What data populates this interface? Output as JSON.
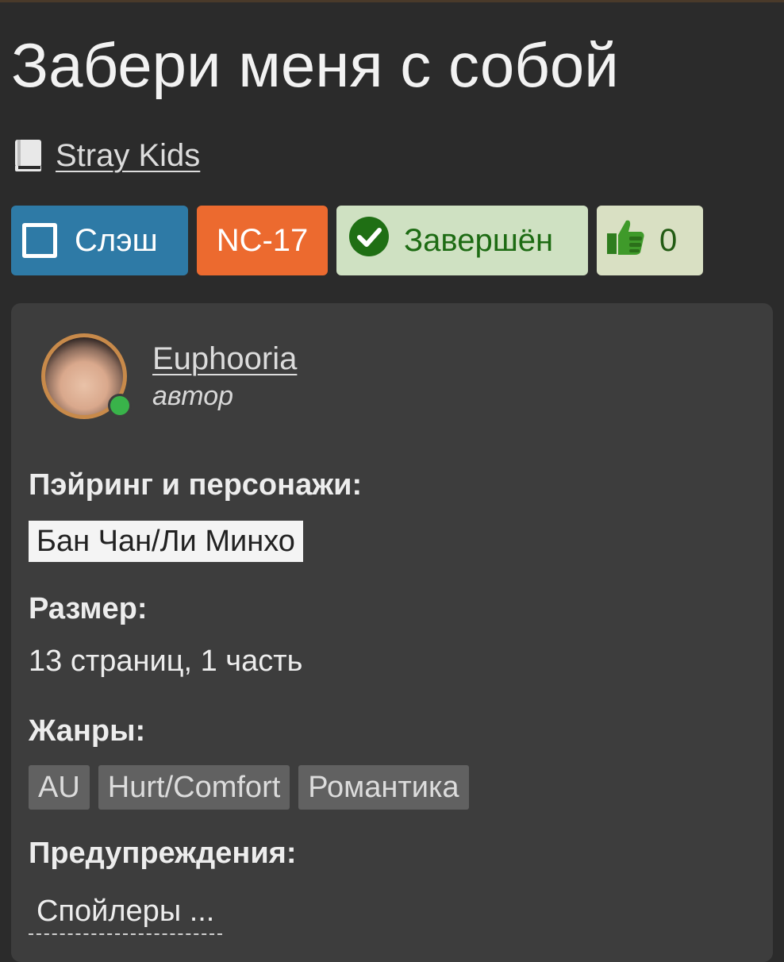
{
  "title": "Забери меня с собой",
  "fandom": {
    "icon": "book-icon",
    "name": "Stray Kids"
  },
  "badges": {
    "direction": {
      "label": "Слэш",
      "icon": "square-icon",
      "color": "#2e7aa6"
    },
    "rating": {
      "label": "NC-17",
      "color": "#ec6a2f"
    },
    "status": {
      "label": "Завершён",
      "icon": "check-circle-icon",
      "color": "#cfe1c2"
    },
    "likes": {
      "count": "0",
      "icon": "thumbs-up-icon",
      "color": "#d9e0c3"
    }
  },
  "author": {
    "name": "Euphooria",
    "role": "автор",
    "online": true
  },
  "pairing": {
    "label": "Пэйринг и персонажи:",
    "value": "Бан Чан/Ли Минхо"
  },
  "size": {
    "label": "Размер:",
    "value": "13 страниц, 1 часть"
  },
  "genres": {
    "label": "Жанры:",
    "items": [
      "AU",
      "Hurt/Comfort",
      "Романтика"
    ]
  },
  "warnings": {
    "label": "Предупреждения:",
    "value": "Спойлеры ..."
  }
}
